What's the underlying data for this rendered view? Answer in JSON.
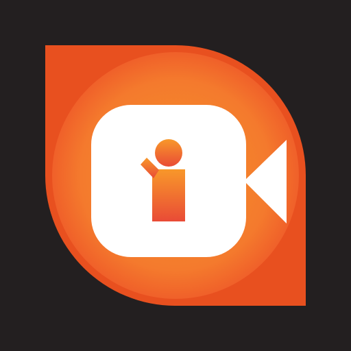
{
  "icon": {
    "name": "video-camera-person-app-icon",
    "colors": {
      "background": "#231f20",
      "leaf_outer": "#e8501f",
      "leaf_inner_light": "#f7922a",
      "leaf_inner_dark": "#ee5528",
      "camera_body": "#ffffff",
      "person_top": "#f8982a",
      "person_bottom": "#e94b36"
    }
  }
}
